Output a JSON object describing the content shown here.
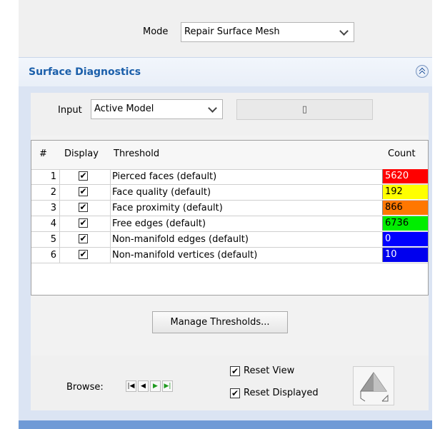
{
  "mode": {
    "label": "Mode",
    "value": "Repair Surface Mesh"
  },
  "panel": {
    "title": "Surface Diagnostics",
    "collapse_icon": "double-chevron-up-icon",
    "input": {
      "label": "Input",
      "value": "Active Model",
      "button_label": "▯"
    },
    "table": {
      "headers": {
        "num": "#",
        "display": "Display",
        "threshold": "Threshold",
        "count": "Count"
      },
      "rows": [
        {
          "num": "1",
          "checked": "✔",
          "name": "Pierced faces (default)",
          "count": "5620",
          "color": "#ff0000",
          "text_color": "#ffffff"
        },
        {
          "num": "2",
          "checked": "✔",
          "name": "Face quality (default)",
          "count": "192",
          "color": "#ffff00",
          "text_color": "#000000"
        },
        {
          "num": "3",
          "checked": "✔",
          "name": "Face proximity (default)",
          "count": "866",
          "color": "#ff7700",
          "text_color": "#000000"
        },
        {
          "num": "4",
          "checked": "✔",
          "name": "Free edges (default)",
          "count": "6736",
          "color": "#00ee00",
          "text_color": "#000000"
        },
        {
          "num": "5",
          "checked": "✔",
          "name": "Non-manifold edges (default)",
          "count": "0",
          "color": "#0000ff",
          "text_color": "#ffffff"
        },
        {
          "num": "6",
          "checked": "✔",
          "name": "Non-manifold vertices (default)",
          "count": "10",
          "color": "#0000ee",
          "text_color": "#ffffff"
        }
      ]
    },
    "manage_label": "Manage Thresholds...",
    "browse": {
      "label": "Browse:",
      "nav_icons": [
        "first-icon",
        "prev-icon",
        "next-icon",
        "last-icon"
      ],
      "nav_glyphs": [
        "|◀",
        "◀",
        "▶",
        "▶|"
      ]
    },
    "reset_view": {
      "label": "Reset View",
      "checked": "✔"
    },
    "reset_displayed": {
      "label": "Reset Displayed",
      "checked": "✔"
    }
  },
  "colors": {
    "accent": "#1b5faa",
    "panel_bg": "#dbe4f3",
    "bottom_bar": "#6f9ad6"
  }
}
